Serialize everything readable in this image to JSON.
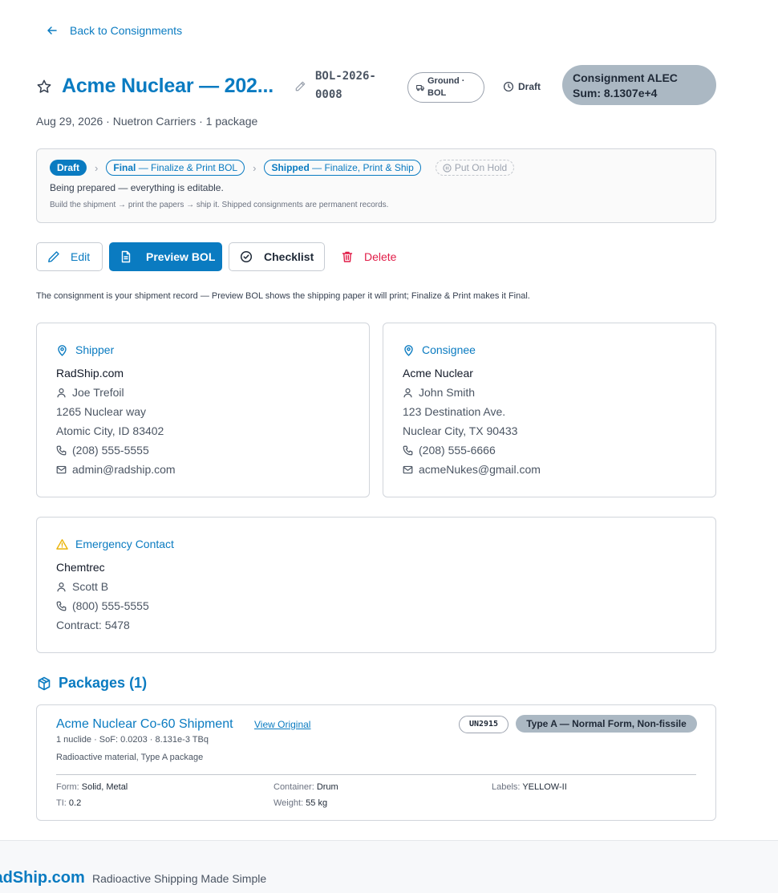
{
  "nav": {
    "back_label": "Back to Consignments"
  },
  "header": {
    "title": "Acme Nuclear — 202...",
    "bol_number_line1": "BOL-2026-",
    "bol_number_line2": "0008",
    "mode_line1": "Ground ·",
    "mode_line2": "BOL",
    "status": "Draft",
    "alec_line1": "Consignment ALEC",
    "alec_line2": "Sum: 8.1307e+4",
    "subline": "Aug 29, 2026 · Nuetron Carriers · 1 package"
  },
  "workflow": {
    "current": "Draft",
    "final_name": "Final",
    "final_action": " — Finalize & Print BOL",
    "shipped_name": "Shipped",
    "shipped_action": " — Finalize, Print & Ship",
    "hold_label": "Put On Hold",
    "description": "Being prepared — everything is editable.",
    "hint": "Build the shipment → print the papers → ship it. Shipped consignments are permanent records."
  },
  "actions": {
    "edit": "Edit",
    "preview": "Preview BOL",
    "checklist": "Checklist",
    "delete": "Delete",
    "note": "The consignment is your shipment record — Preview BOL shows the shipping paper it will print; Finalize & Print makes it Final."
  },
  "shipper": {
    "heading": "Shipper",
    "name": "RadShip.com",
    "contact": "Joe Trefoil",
    "address1": "1265 Nuclear way",
    "address2": "Atomic City, ID 83402",
    "phone": "(208) 555-5555",
    "email": "admin@radship.com"
  },
  "consignee": {
    "heading": "Consignee",
    "name": "Acme Nuclear",
    "contact": "John Smith",
    "address1": "123 Destination Ave.",
    "address2": "Nuclear City, TX 90433",
    "phone": "(208) 555-6666",
    "email": "acmeNukes@gmail.com"
  },
  "emergency": {
    "heading": "Emergency Contact",
    "name": "Chemtrec",
    "contact": "Scott B",
    "phone": "(800) 555-5555",
    "contract": "Contract: 5478"
  },
  "packages": {
    "heading": "Packages (1)",
    "items": [
      {
        "title": "Acme Nuclear Co-60 Shipment",
        "link": "View Original",
        "un": "UN2915",
        "type": "Type A — Normal Form, Non-fissile",
        "summary": "1 nuclide · SoF: 0.0203 · 8.131e-3 TBq",
        "description": "Radioactive material, Type A package",
        "form_label": "Form: ",
        "form": "Solid, Metal",
        "container_label": "Container: ",
        "container": "Drum",
        "labels_label": "Labels: ",
        "labels": "YELLOW-II",
        "ti_label": "TI: ",
        "ti": "0.2",
        "weight_label": "Weight: ",
        "weight": "55 kg"
      }
    ]
  },
  "footer": {
    "brand": "RadShip.com",
    "tagline": "Radioactive Shipping Made Simple"
  },
  "colors": {
    "accent": "#0a7bc1",
    "danger": "#e11d48",
    "warning": "#eab308",
    "pill_gray": "#abb8c3"
  }
}
